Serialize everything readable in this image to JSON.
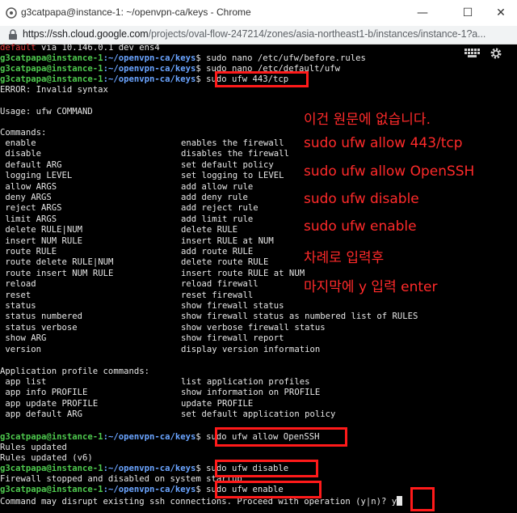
{
  "window": {
    "title": "g3catpapa@instance-1: ~/openvpn-ca/keys - Chrome",
    "minimize": "—",
    "maximize": "☐",
    "close": "✕"
  },
  "address": {
    "url_host": "https://ssh.cloud.google.com",
    "url_path": "/projects/oval-flow-247214/zones/asia-northeast1-b/instances/instance-1?a..."
  },
  "prompt": {
    "user": "g3catpapa@instance-1",
    "path": ":~/openvpn-ca/keys",
    "sign": "$ "
  },
  "lines": {
    "l0_red": "default",
    "l0_rest": " via 10.146.0.1 dev ens4",
    "cmd1": "sudo nano /etc/ufw/before.rules",
    "cmd2": "sudo nano /etc/default/ufw",
    "cmd3": "sudo ufw 443/tcp",
    "error": "ERROR: Invalid syntax",
    "usage": "Usage: ufw COMMAND",
    "commands_header": "Commands:",
    "app_header": "Application profile commands:",
    "cmd4": "sudo ufw allow OpenSSH",
    "rules1": "Rules updated",
    "rules2": "Rules updated (v6)",
    "cmd5": "sudo ufw disable",
    "fw_stopped": "Firewall stopped and disabled on system startup",
    "cmd6": "sudo ufw enable",
    "proceed": "Command may disrupt existing ssh connections. Proceed with operation (y|n)? y"
  },
  "commands": [
    [
      "enable",
      "enables the firewall"
    ],
    [
      "disable",
      "disables the firewall"
    ],
    [
      "default ARG",
      "set default policy"
    ],
    [
      "logging LEVEL",
      "set logging to LEVEL"
    ],
    [
      "allow ARGS",
      "add allow rule"
    ],
    [
      "deny ARGS",
      "add deny rule"
    ],
    [
      "reject ARGS",
      "add reject rule"
    ],
    [
      "limit ARGS",
      "add limit rule"
    ],
    [
      "delete RULE|NUM",
      "delete RULE"
    ],
    [
      "insert NUM RULE",
      "insert RULE at NUM"
    ],
    [
      "route RULE",
      "add route RULE"
    ],
    [
      "route delete RULE|NUM",
      "delete route RULE"
    ],
    [
      "route insert NUM RULE",
      "insert route RULE at NUM"
    ],
    [
      "reload",
      "reload firewall"
    ],
    [
      "reset",
      "reset firewall"
    ],
    [
      "status",
      "show firewall status"
    ],
    [
      "status numbered",
      "show firewall status as numbered list of RULES"
    ],
    [
      "status verbose",
      "show verbose firewall status"
    ],
    [
      "show ARG",
      "show firewall report"
    ],
    [
      "version",
      "display version information"
    ]
  ],
  "app_commands": [
    [
      "app list",
      "list application profiles"
    ],
    [
      "app info PROFILE",
      "show information on PROFILE"
    ],
    [
      "app update PROFILE",
      "update PROFILE"
    ],
    [
      "app default ARG",
      "set default application policy"
    ]
  ],
  "annotations": [
    "이건 원문에 없습니다.",
    "sudo ufw allow 443/tcp",
    "sudo ufw allow OpenSSH",
    "sudo ufw disable",
    "sudo ufw enable",
    "차례로 입력후",
    "마지막에 y 입력 enter"
  ],
  "colors": {
    "prompt_green": "#4ec94e",
    "path_blue": "#6aa4ff",
    "annotation_red": "#ff2a2a",
    "highlight_red": "#ff1a1a"
  },
  "icons": {
    "window": "terminal-favicon",
    "lock": "lock-icon",
    "keyboard": "keyboard-icon",
    "settings": "gear-icon"
  }
}
